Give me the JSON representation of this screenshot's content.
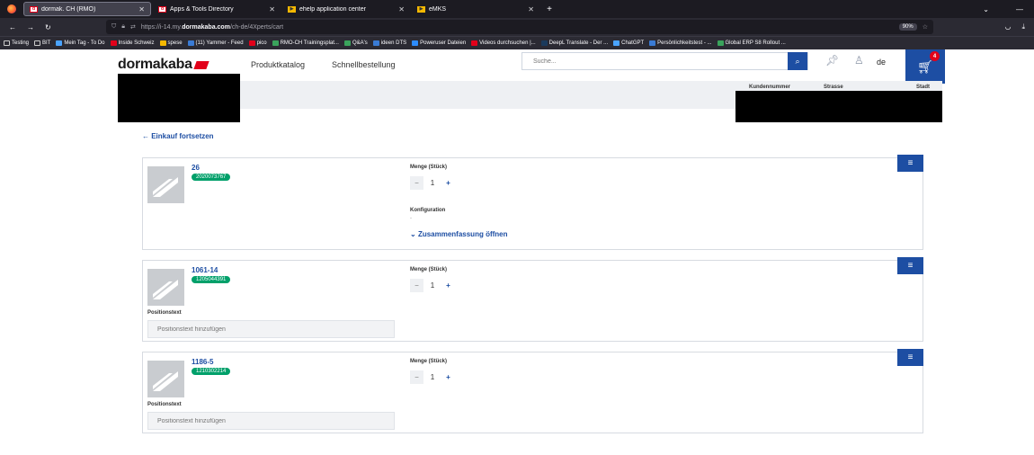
{
  "browser": {
    "tabs": [
      {
        "title": "dormak. CH (RMO)",
        "favicon": "dormakaba-favicon"
      },
      {
        "title": "Apps & Tools Directory",
        "favicon": "dormakaba-favicon"
      },
      {
        "title": "ehelp application center",
        "favicon": "ehelp-favicon"
      },
      {
        "title": "eMKS",
        "favicon": "emks-favicon"
      }
    ],
    "url_prefix": "https://i-14.my.",
    "url_domain": "dormakaba.com",
    "url_path": "/ch-de/4Xperts/cart",
    "zoom": "90%",
    "bookmarks": [
      "Testing",
      "BIT",
      "Mein Tag - To Do",
      "Inside Schweiz",
      "spese",
      "(11) Yammer - Feed",
      "pico",
      "RMO-CH Trainingsplat...",
      "Q&A's",
      "ideen DTS",
      "Poweruser Dateien",
      "Videos durchsuchen |...",
      "DeepL Translate - Der ...",
      "ChatGPT",
      "Persönlichkeitstest - ...",
      "Global ERP S8 Rollout ..."
    ]
  },
  "header": {
    "logo": "dormakaba",
    "nav": [
      "Produktkatalog",
      "Schnellbestellung"
    ],
    "search_placeholder": "Suche...",
    "lang": "de",
    "cart_count": "4"
  },
  "customer": {
    "columns": [
      "Kundennummer",
      "Strasse",
      "Stadt"
    ]
  },
  "back_link": "← Einkauf fortsetzen",
  "items": [
    {
      "name": "26",
      "sku": "2020073767",
      "qty_label": "Menge (Stück)",
      "qty": "1",
      "config_label": "Konfiguration",
      "config_value": "-",
      "summary_link": "Zusammenfassung öffnen"
    },
    {
      "name": "1061-14",
      "sku": "1205044391",
      "qty_label": "Menge (Stück)",
      "qty": "1",
      "pos_label": "Positionstext",
      "pos_placeholder": "Positionstext hinzufügen"
    },
    {
      "name": "1186-5",
      "sku": "1210302214",
      "qty_label": "Menge (Stück)",
      "qty": "1",
      "pos_label": "Positionstext",
      "pos_placeholder": "Positionstext hinzufügen"
    }
  ],
  "colors": {
    "brand_blue": "#1d4ea3",
    "brand_red": "#e2001a",
    "sku_green": "#00a06a"
  }
}
